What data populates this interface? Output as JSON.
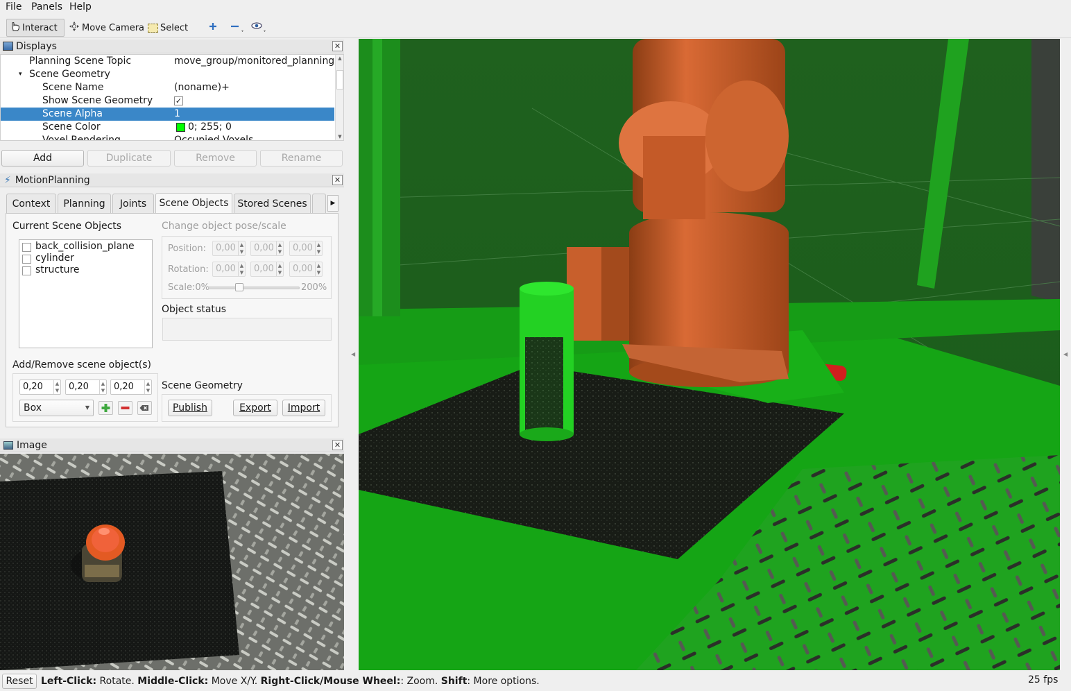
{
  "menubar": {
    "file": "File",
    "panels": "Panels",
    "help": "Help"
  },
  "toolbar": {
    "interact": "Interact",
    "move_camera": "Move Camera",
    "select": "Select"
  },
  "displays": {
    "title": "Displays",
    "rows": [
      {
        "name": "Planning Scene Topic",
        "value": "move_group/monitored_planning..."
      },
      {
        "name": "Scene Geometry",
        "value": ""
      },
      {
        "name": "Scene Name",
        "value": "(noname)+"
      },
      {
        "name": "Show Scene Geometry",
        "value": "✓"
      },
      {
        "name": "Scene Alpha",
        "value": "1"
      },
      {
        "name": "Scene Color",
        "value": "0; 255; 0"
      },
      {
        "name": "Voxel Rendering",
        "value": "Occupied Voxels"
      }
    ],
    "scene_color_hex": "#00ff00",
    "buttons": {
      "add": "Add",
      "duplicate": "Duplicate",
      "remove": "Remove",
      "rename": "Rename"
    }
  },
  "motion_planning": {
    "title": "MotionPlanning",
    "tabs": [
      "Context",
      "Planning",
      "Joints",
      "Scene Objects",
      "Stored Scenes"
    ],
    "active_tab": "Scene Objects",
    "current_scene_objects_label": "Current Scene Objects",
    "objects": [
      "back_collision_plane",
      "cylinder",
      "structure"
    ],
    "change_pose_label": "Change object pose/scale",
    "position_label": "Position:",
    "rotation_label": "Rotation:",
    "scale_label": "Scale:0%",
    "scale_max": "200%",
    "scale_value": 0.33,
    "pose_value": "0,00",
    "object_status_label": "Object status",
    "add_remove_label": "Add/Remove scene object(s)",
    "sizes": [
      "0,20",
      "0,20",
      "0,20"
    ],
    "shape": "Box",
    "scene_geometry_label": "Scene Geometry",
    "publish": "Publish",
    "export": "Export",
    "import": "Import"
  },
  "image_panel": {
    "title": "Image"
  },
  "status": {
    "reset": "Reset",
    "k1": "Left-Click:",
    "v1": " Rotate. ",
    "k2": "Middle-Click:",
    "v2": " Move X/Y. ",
    "k3": "Right-Click/Mouse Wheel:",
    "v3": ": Zoom. ",
    "k4": "Shift",
    "v4": ": More options.",
    "fps": "25 fps"
  }
}
